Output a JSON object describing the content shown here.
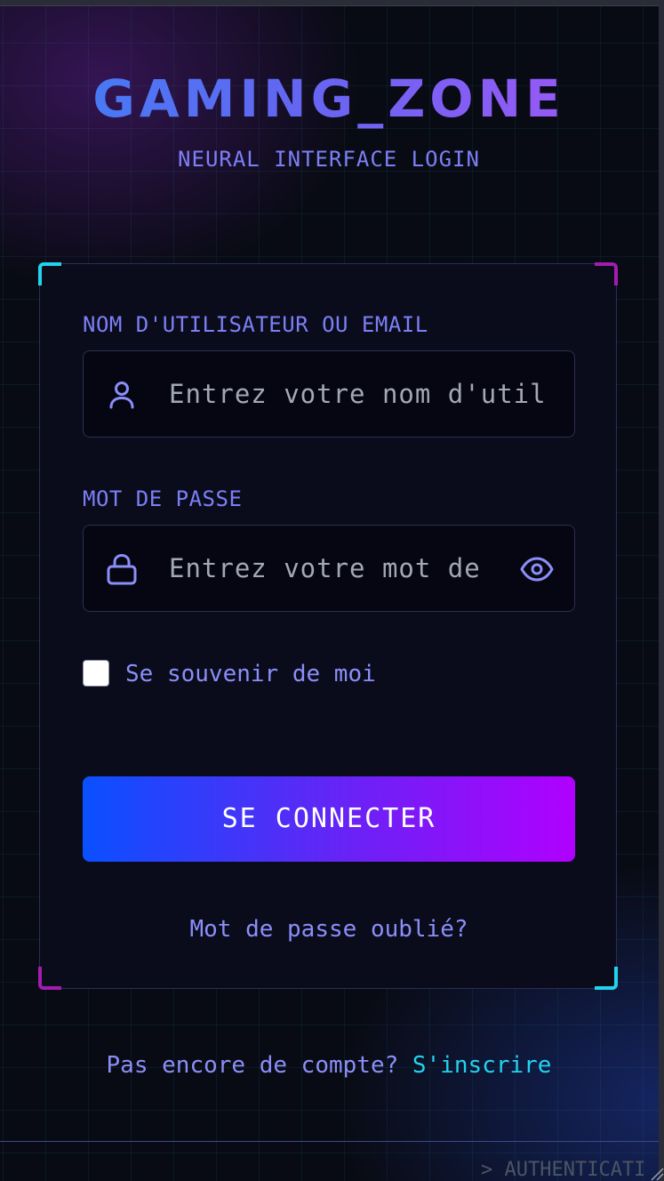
{
  "header": {
    "title": "GAMING_ZONE",
    "subtitle": "NEURAL INTERFACE LOGIN"
  },
  "form": {
    "username": {
      "label": "NOM D'UTILISATEUR OU EMAIL",
      "placeholder": "Entrez votre nom d'utilisateur",
      "value": "",
      "icon": "user-icon"
    },
    "password": {
      "label": "MOT DE PASSE",
      "placeholder": "Entrez votre mot de passe",
      "value": "",
      "icon": "lock-icon",
      "toggle_icon": "eye-icon"
    },
    "remember": {
      "label": "Se souvenir de moi",
      "checked": false
    },
    "submit_label": "SE CONNECTER",
    "forgot_label": "Mot de passe oublié?"
  },
  "signup": {
    "prompt": "Pas encore de compte?",
    "link": "S'inscrire"
  },
  "footer": {
    "terminal": "> AUTHENTICATI"
  },
  "colors": {
    "accent_cyan": "#22d3ee",
    "accent_purple": "#a21caf",
    "label": "#7c7ff5",
    "button_start": "#0a50ff",
    "button_end": "#b000ff"
  }
}
